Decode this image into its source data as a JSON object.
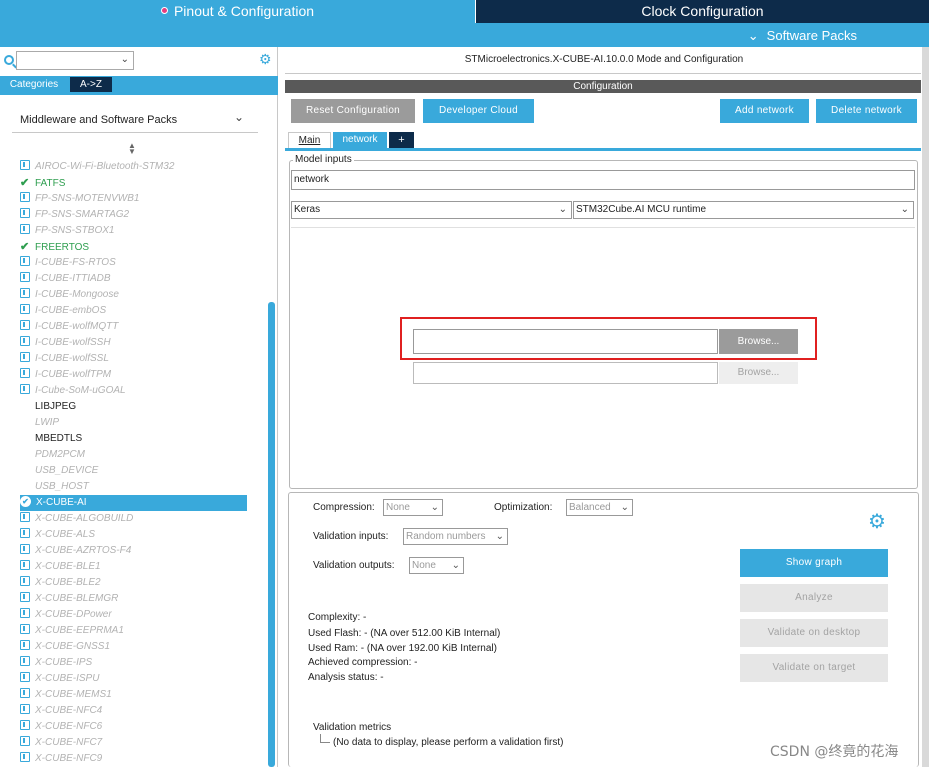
{
  "top_tabs": {
    "pinout": "Pinout & Configuration",
    "clock": "Clock Configuration",
    "software_packs": "Software Packs"
  },
  "left": {
    "categories_tab": "Categories",
    "az_tab": "A->Z",
    "group_title": "Middleware and Software Packs",
    "items": [
      {
        "label": "AIROC-Wi-Fi-Bluetooth-STM32",
        "state": "disabled-icon"
      },
      {
        "label": "FATFS",
        "state": "checked"
      },
      {
        "label": "FP-SNS-MOTENVWB1",
        "state": "disabled-icon"
      },
      {
        "label": "FP-SNS-SMARTAG2",
        "state": "disabled-icon"
      },
      {
        "label": "FP-SNS-STBOX1",
        "state": "disabled-icon"
      },
      {
        "label": "FREERTOS",
        "state": "checked"
      },
      {
        "label": "I-CUBE-FS-RTOS",
        "state": "disabled-icon"
      },
      {
        "label": "I-CUBE-ITTIADB",
        "state": "disabled-icon"
      },
      {
        "label": "I-CUBE-Mongoose",
        "state": "disabled-icon"
      },
      {
        "label": "I-CUBE-embOS",
        "state": "disabled-icon"
      },
      {
        "label": "I-CUBE-wolfMQTT",
        "state": "disabled-icon"
      },
      {
        "label": "I-CUBE-wolfSSH",
        "state": "disabled-icon"
      },
      {
        "label": "I-CUBE-wolfSSL",
        "state": "disabled-icon"
      },
      {
        "label": "I-CUBE-wolfTPM",
        "state": "disabled-icon"
      },
      {
        "label": "I-Cube-SoM-uGOAL",
        "state": "disabled-icon"
      },
      {
        "label": "LIBJPEG",
        "state": "plain"
      },
      {
        "label": "LWIP",
        "state": "disabled-plain"
      },
      {
        "label": "MBEDTLS",
        "state": "plain"
      },
      {
        "label": "PDM2PCM",
        "state": "disabled-plain"
      },
      {
        "label": "USB_DEVICE",
        "state": "disabled-plain"
      },
      {
        "label": "USB_HOST",
        "state": "disabled-plain"
      },
      {
        "label": "X-CUBE-AI",
        "state": "selected"
      },
      {
        "label": "X-CUBE-ALGOBUILD",
        "state": "disabled-icon"
      },
      {
        "label": "X-CUBE-ALS",
        "state": "disabled-icon"
      },
      {
        "label": "X-CUBE-AZRTOS-F4",
        "state": "disabled-icon"
      },
      {
        "label": "X-CUBE-BLE1",
        "state": "disabled-icon"
      },
      {
        "label": "X-CUBE-BLE2",
        "state": "disabled-icon"
      },
      {
        "label": "X-CUBE-BLEMGR",
        "state": "disabled-icon"
      },
      {
        "label": "X-CUBE-DPower",
        "state": "disabled-icon"
      },
      {
        "label": "X-CUBE-EEPRMA1",
        "state": "disabled-icon"
      },
      {
        "label": "X-CUBE-GNSS1",
        "state": "disabled-icon"
      },
      {
        "label": "X-CUBE-IPS",
        "state": "disabled-icon"
      },
      {
        "label": "X-CUBE-ISPU",
        "state": "disabled-icon"
      },
      {
        "label": "X-CUBE-MEMS1",
        "state": "disabled-icon"
      },
      {
        "label": "X-CUBE-NFC4",
        "state": "disabled-icon"
      },
      {
        "label": "X-CUBE-NFC6",
        "state": "disabled-icon"
      },
      {
        "label": "X-CUBE-NFC7",
        "state": "disabled-icon"
      },
      {
        "label": "X-CUBE-NFC9",
        "state": "disabled-icon"
      }
    ]
  },
  "right": {
    "title": "STMicroelectronics.X-CUBE-AI.10.0.0 Mode and Configuration",
    "config_label": "Configuration",
    "buttons": {
      "reset": "Reset Configuration",
      "dev_cloud": "Developer Cloud",
      "add_network": "Add network",
      "delete_network": "Delete network"
    },
    "tabs": {
      "main": "Main",
      "network": "network",
      "plus": "+"
    },
    "model_inputs": {
      "legend": "Model inputs",
      "network_name": "network",
      "framework": "Keras",
      "runtime": "STM32Cube.AI MCU runtime",
      "browse1": "Browse...",
      "browse2": "Browse..."
    },
    "settings": {
      "compression_label": "Compression:",
      "compression_value": "None",
      "optimization_label": "Optimization:",
      "optimization_value": "Balanced",
      "validation_inputs_label": "Validation inputs:",
      "validation_inputs_value": "Random numbers",
      "validation_outputs_label": "Validation outputs:",
      "validation_outputs_value": "None"
    },
    "actions": {
      "show_graph": "Show graph",
      "analyze": "Analyze",
      "validate_desktop": "Validate on desktop",
      "validate_target": "Validate on target"
    },
    "stats": {
      "complexity": "Complexity: -",
      "flash": "Used Flash: - (NA over 512.00 KiB Internal)",
      "ram": "Used Ram: - (NA over 192.00 KiB Internal)",
      "compression": "Achieved compression: -",
      "status": "Analysis status: -"
    },
    "validation_metrics": {
      "title": "Validation metrics",
      "empty": "(No data to display, please perform a validation first)"
    }
  },
  "watermark": "CSDN @终竟的花海",
  "colors": {
    "accent": "#39a9db",
    "navy": "#0d2b4a",
    "highlight_box": "#e02020"
  }
}
